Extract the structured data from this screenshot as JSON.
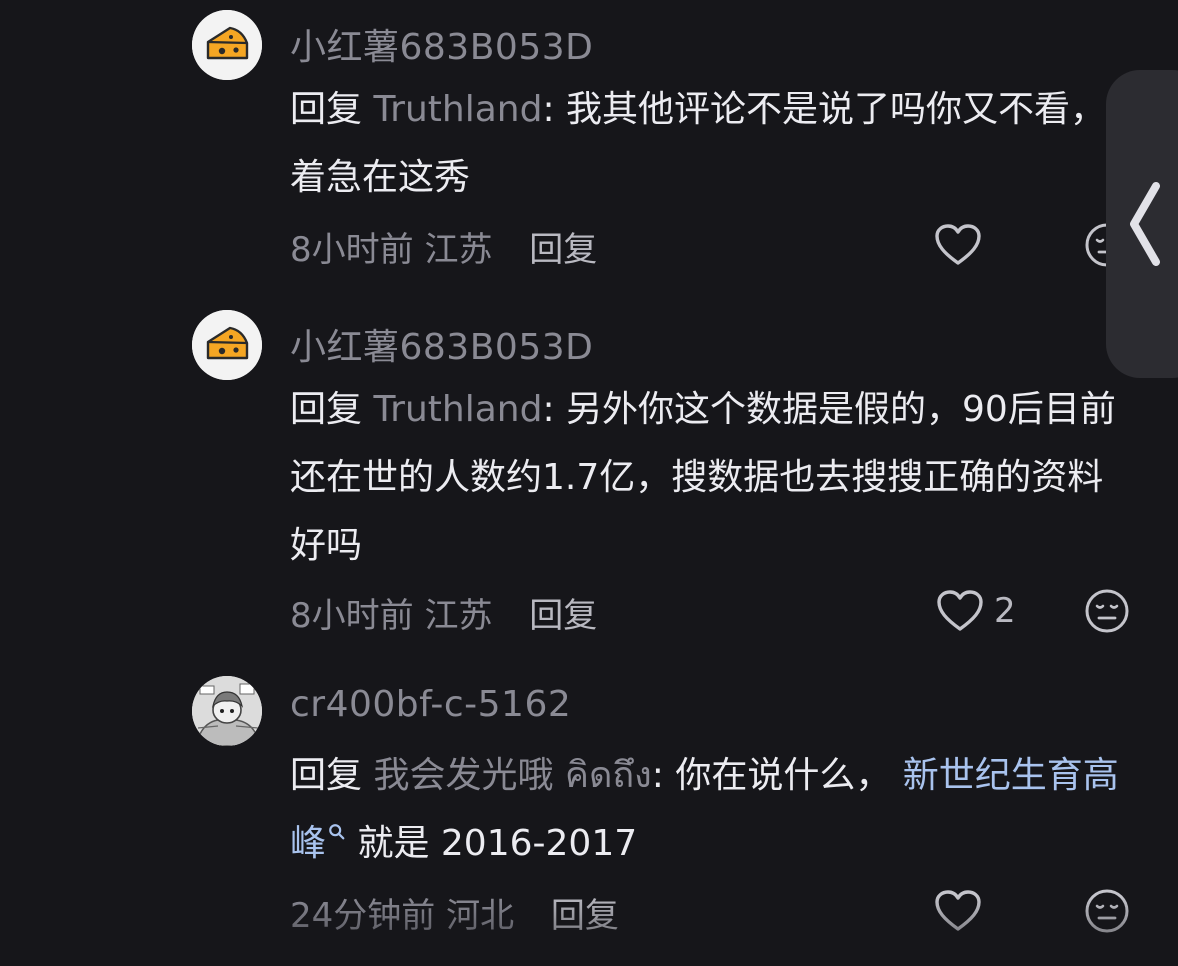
{
  "comments": [
    {
      "username": "小红薯683B053D",
      "reply_word": "回复",
      "reply_target": "Truthland",
      "text": ": 我其他评论不是说了吗你又不看，着急在这秀",
      "time": "8小时前",
      "location": "江苏",
      "reply_label": "回复",
      "likes": "",
      "avatar": "cheese-icon"
    },
    {
      "username": "小红薯683B053D",
      "reply_word": "回复",
      "reply_target": "Truthland",
      "text": ": 另外你这个数据是假的，90后目前还在世的人数约1.7亿，搜数据也去搜搜正确的资料好吗",
      "time": "8小时前",
      "location": "江苏",
      "reply_label": "回复",
      "likes": "2",
      "avatar": "cheese-icon"
    },
    {
      "username": "cr400bf-c-5162",
      "reply_word": "回复",
      "reply_target": "我会发光哦 คิดถึง",
      "text": ": 你在说什么， ",
      "topic": "新世纪生育高峰",
      "text_after": " 就是 2016-2017",
      "time": "24分钟前",
      "location": "河北",
      "reply_label": "回复",
      "likes": "",
      "avatar": "manga-avatar-icon"
    }
  ],
  "side_handle_icon": "chevron-left-icon",
  "colors": {
    "background": "#16161a",
    "muted": "#8a8a94",
    "text": "#ececf1",
    "topic": "#a9c3ee",
    "cheese": "#f5a623"
  }
}
